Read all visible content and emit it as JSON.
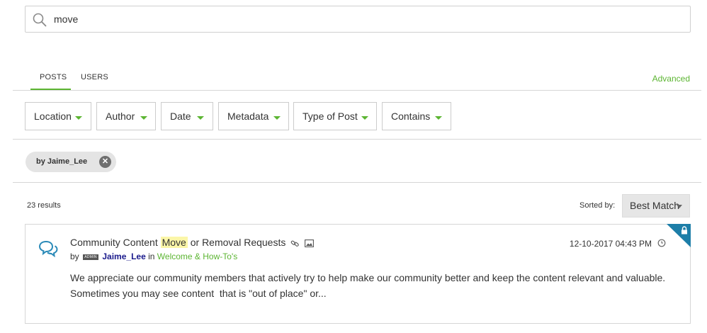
{
  "search": {
    "value": "move",
    "placeholder": ""
  },
  "tabs": [
    {
      "label": "POSTS"
    },
    {
      "label": "USERS"
    }
  ],
  "advanced_label": "Advanced",
  "filters": [
    {
      "label": "Location"
    },
    {
      "label": "Author"
    },
    {
      "label": "Date"
    },
    {
      "label": "Metadata"
    },
    {
      "label": "Type of Post"
    },
    {
      "label": "Contains"
    }
  ],
  "active_filter": {
    "label": "by Jaime_Lee"
  },
  "results": {
    "count_text": "23 results",
    "sorted_by_label": "Sorted by:",
    "sort_value": "Best Match"
  },
  "post": {
    "title_before": "Community Content ",
    "title_highlight": "Move",
    "title_after": " or Removal Requests",
    "by": "by",
    "admin_badge": "ADMIN",
    "author": "Jaime_Lee",
    "in": "in",
    "board": "Welcome & How-To's",
    "date": "12-10-2017 04:43 PM",
    "excerpt_line1": "We appreciate our community members that actively try to help make our community better and keep the content relevant and valuable.",
    "excerpt_line2": "Sometimes you may see content  that is \"out of place\" or..."
  },
  "colors": {
    "accent": "#5cb532",
    "author": "#1a1a8c",
    "flag": "#1d7ea8",
    "icon": "#2a8ab8",
    "highlight": "#fbf6a8"
  },
  "icons": [
    "search-icon",
    "chevron-down-icon",
    "close-icon",
    "chat-bubbles-icon",
    "link-icon",
    "image-icon",
    "clock-icon",
    "lock-icon"
  ]
}
